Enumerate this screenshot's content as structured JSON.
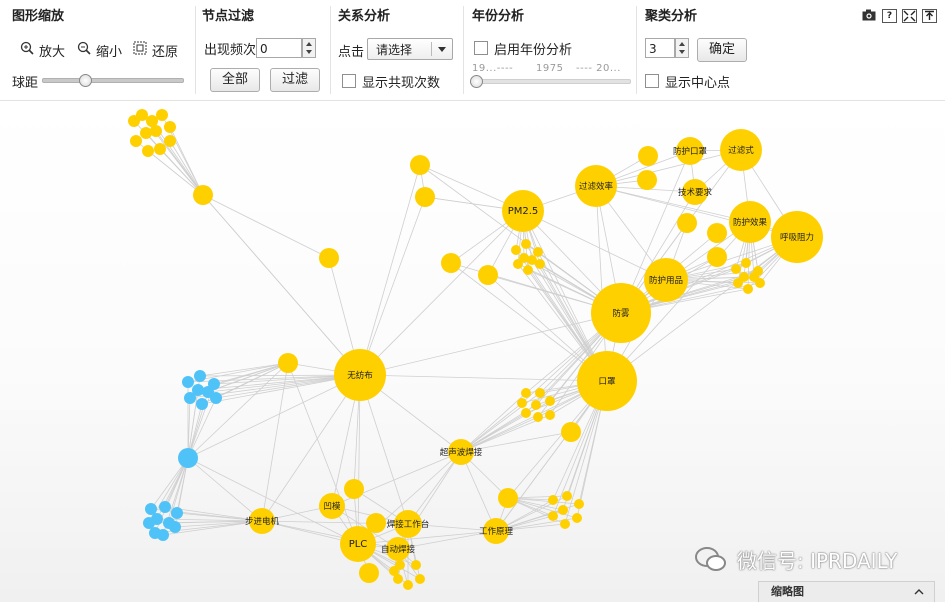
{
  "toolbar": {
    "zoom": {
      "title": "图形缩放",
      "zoom_in": "放大",
      "zoom_out": "缩小",
      "reset": "还原",
      "distance": "球距"
    },
    "filter": {
      "title": "节点过滤",
      "freq_label": "出现频次",
      "freq_value": "0",
      "all_btn": "全部",
      "filter_btn": "过滤"
    },
    "relation": {
      "title": "关系分析",
      "click_label": "点击",
      "select_value": "请选择",
      "show_cooccur": "显示共现次数"
    },
    "year": {
      "title": "年份分析",
      "enable": "启用年份分析",
      "start": "19...----",
      "mid": "1975",
      "end": "---- 20..."
    },
    "cluster": {
      "title": "聚类分析",
      "count_value": "3",
      "confirm_btn": "确定",
      "show_center": "显示中心点"
    },
    "icons": [
      "camera-icon",
      "help-icon",
      "fit-icon",
      "export-icon"
    ]
  },
  "colors": {
    "yellow": "#FFD000",
    "blue": "#4FC3F7",
    "edge": "#cfcfcf"
  },
  "graph": {
    "labels": {
      "pm25": "PM2.5",
      "guolv_xiaolv": "过滤效率",
      "fanghu_kouzhao": "防护口罩",
      "guolvshi": "过滤式",
      "jishu_yaoqiu": "技术要求",
      "fanghu_xiaoguo": "防护效果",
      "huxi_zuli": "呼吸阻力",
      "fanghu_yongpin": "防护用品",
      "fangwu": "防雾",
      "kouzhao": "口罩",
      "wufangbu": "无纺布",
      "chaoshengbo": "超声波焊接",
      "bujin_dianji": "步进电机",
      "tuyuan": "凹模",
      "hanjie_gongzuotai": "焊接工作台",
      "plc": "PLC",
      "zidong_hanjie": "自动焊接",
      "gongzuo_yuanli": "工作原理"
    }
  },
  "minimap": {
    "label": "缩略图"
  },
  "watermark": "微信号: IPRDAILY"
}
